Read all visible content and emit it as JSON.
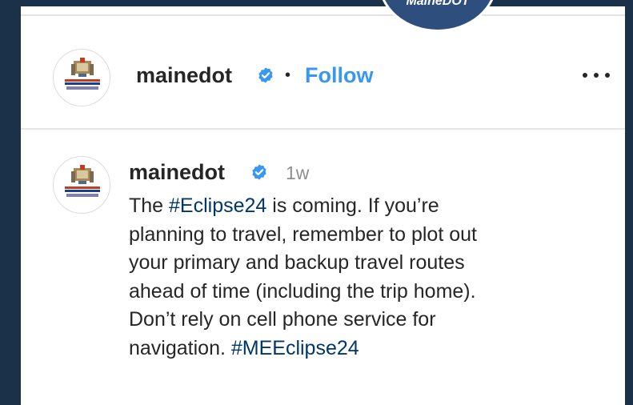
{
  "badge": {
    "text": "MaineDOT"
  },
  "post_header": {
    "username": "mainedot",
    "separator": "•",
    "follow_label": "Follow",
    "more_icon": "more-horizontal-icon",
    "verified_icon": "verified-badge-icon"
  },
  "comment": {
    "username": "mainedot",
    "time": "1w",
    "caption": {
      "segments": [
        {
          "text": "The ",
          "type": "text"
        },
        {
          "text": "#Eclipse24",
          "type": "hashtag"
        },
        {
          "text": " is coming. If you’re\nplanning to travel, remember to plot out\nyour primary and backup travel routes\nahead of time (including the trip home).\nDon’t rely on cell phone service for\nnavigation. ",
          "type": "text"
        },
        {
          "text": "#MEEclipse24",
          "type": "hashtag"
        }
      ]
    }
  },
  "colors": {
    "frame": "#1b3049",
    "badge": "#2e4f7e",
    "follow": "#3897f0",
    "verified": "#3897f0",
    "hashtag": "#00376b",
    "text": "#262626",
    "muted": "#8e8e8e"
  }
}
